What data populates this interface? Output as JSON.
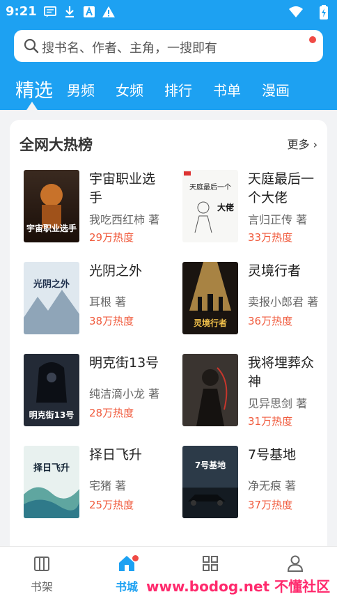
{
  "status_bar": {
    "time": "9:21",
    "icons": [
      "message-icon",
      "download-icon",
      "font-app-icon",
      "warning-icon",
      "wifi-icon",
      "battery-icon"
    ]
  },
  "search": {
    "placeholder": "搜书名、作者、主角，一搜即有"
  },
  "tabs": [
    {
      "label": "精选",
      "active": true
    },
    {
      "label": "男频",
      "active": false
    },
    {
      "label": "女频",
      "active": false
    },
    {
      "label": "排行",
      "active": false
    },
    {
      "label": "书单",
      "active": false
    },
    {
      "label": "漫画",
      "active": false
    }
  ],
  "ranking": {
    "title": "全网大热榜",
    "more": "更多",
    "books": [
      {
        "title": "宇宙职业选手",
        "author": "我吃西红柿 著",
        "heat": "29万热度"
      },
      {
        "title": "天庭最后一个大佬",
        "author": "言归正传 著",
        "heat": "33万热度"
      },
      {
        "title": "光阴之外",
        "author": "耳根 著",
        "heat": "38万热度"
      },
      {
        "title": "灵境行者",
        "author": "卖报小郎君 著",
        "heat": "36万热度"
      },
      {
        "title": "明克街13号",
        "author": "纯洁滴小龙 著",
        "heat": "28万热度"
      },
      {
        "title": "我将埋葬众神",
        "author": "见异思剑 著",
        "heat": "31万热度"
      },
      {
        "title": "择日飞升",
        "author": "宅猪 著",
        "heat": "25万热度"
      },
      {
        "title": "7号基地",
        "author": "净无痕 著",
        "heat": "37万热度"
      }
    ],
    "covers": [
      {
        "text": "宇宙职业选手"
      },
      {
        "text": "天庭最后一个",
        "subtext": "大佬"
      },
      {
        "text": "光阴之外"
      },
      {
        "text": "灵境行者"
      },
      {
        "text": "明克街13号"
      },
      {
        "text": ""
      },
      {
        "text": "择日飞升"
      },
      {
        "text": "7号基地"
      }
    ]
  },
  "bottom_nav": [
    {
      "label": "书架",
      "icon": "bookshelf-icon",
      "active": false
    },
    {
      "label": "书城",
      "icon": "bookstore-home-icon",
      "active": true
    },
    {
      "label": "",
      "icon": "grid-category-icon",
      "active": false
    },
    {
      "label": "",
      "icon": "user-profile-icon",
      "active": false
    }
  ],
  "watermark": "www.bodog.net 不懂社区",
  "colors": {
    "accent": "#1da1f2",
    "heat": "#f05a3c",
    "badge": "#f04a45"
  }
}
